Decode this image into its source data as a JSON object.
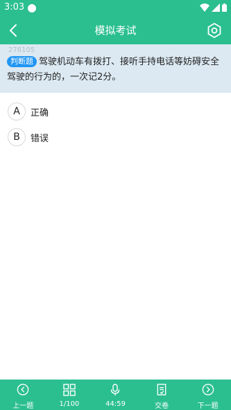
{
  "status_bar": {
    "time": "3:03"
  },
  "header": {
    "title": "模拟考试"
  },
  "question": {
    "id": "276105",
    "type_badge": "判断题",
    "text": "驾驶机动车有拨打、接听手持电话等妨碍安全驾驶的行为的，一次记2分。"
  },
  "options": [
    {
      "letter": "A",
      "text": "正确"
    },
    {
      "letter": "B",
      "text": "错误"
    }
  ],
  "bottom_nav": {
    "prev": "上一题",
    "progress": "1/100",
    "timer": "44:59",
    "submit": "交卷",
    "next": "下一题"
  },
  "colors": {
    "primary": "#2bbf8f",
    "question_bg": "#dce9f2",
    "badge": "#2196f3"
  }
}
